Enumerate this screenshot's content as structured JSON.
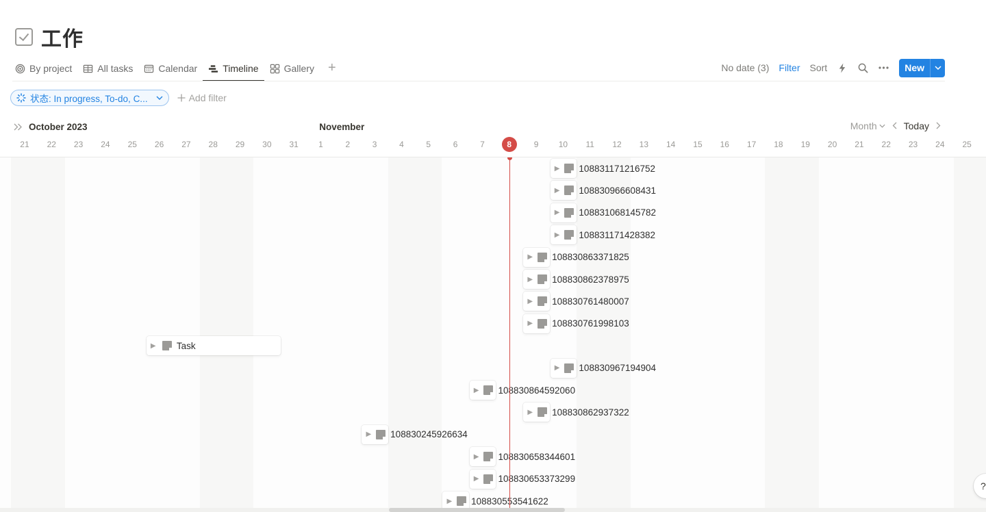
{
  "page": {
    "title": "工作",
    "title_icon": "checkbox-icon"
  },
  "views": {
    "tabs": [
      {
        "label": "By project",
        "icon": "target-icon",
        "active": false
      },
      {
        "label": "All tasks",
        "icon": "table-icon",
        "active": false
      },
      {
        "label": "Calendar",
        "icon": "calendar-icon",
        "active": false
      },
      {
        "label": "Timeline",
        "icon": "timeline-icon",
        "active": true
      },
      {
        "label": "Gallery",
        "icon": "gallery-icon",
        "active": false
      }
    ],
    "add_view_label": "+"
  },
  "toolbar": {
    "no_date": "No date (3)",
    "filter": "Filter",
    "sort": "Sort",
    "automation_icon": "lightning-icon",
    "search_icon": "search-icon",
    "more_icon": "ellipsis-icon",
    "new_label": "New"
  },
  "filters": {
    "status_chip": "状态: In progress, To-do, C...",
    "add_filter": "Add filter"
  },
  "timeline": {
    "expand_icon": "double-chevron-right-icon",
    "months": [
      {
        "label": "October 2023",
        "anchor_index": 0.6
      },
      {
        "label": "November",
        "anchor_index": 12.3
      }
    ],
    "view_mode": "Month",
    "today_label": "Today",
    "start_date": "2023-10-20",
    "days": [
      "0",
      "21",
      "22",
      "23",
      "24",
      "25",
      "26",
      "27",
      "28",
      "29",
      "30",
      "31",
      "1",
      "2",
      "3",
      "4",
      "5",
      "6",
      "7",
      "8",
      "9",
      "10",
      "11",
      "12",
      "13",
      "14",
      "15",
      "16",
      "17",
      "18",
      "19",
      "20",
      "21",
      "22",
      "23",
      "24",
      "25"
    ],
    "day_prefix_first": "20",
    "today_index": 19,
    "weekend_indices": [
      1,
      8,
      15,
      22,
      29,
      36
    ],
    "tasks": [
      {
        "label": "108831171216752",
        "start_index": 21,
        "days": 1
      },
      {
        "label": "108830966608431",
        "start_index": 21,
        "days": 1
      },
      {
        "label": "108831068145782",
        "start_index": 21,
        "days": 1
      },
      {
        "label": "108831171428382",
        "start_index": 21,
        "days": 1
      },
      {
        "label": "108830863371825",
        "start_index": 20,
        "days": 1
      },
      {
        "label": "108830862378975",
        "start_index": 20,
        "days": 1
      },
      {
        "label": "108830761480007",
        "start_index": 20,
        "days": 1
      },
      {
        "label": "108830761998103",
        "start_index": 20,
        "days": 1
      },
      {
        "label": "Task",
        "start_index": 6,
        "days": 5
      },
      {
        "label": "108830967194904",
        "start_index": 21,
        "days": 1
      },
      {
        "label": "108830864592060",
        "start_index": 18,
        "days": 1
      },
      {
        "label": "108830862937322",
        "start_index": 20,
        "days": 1
      },
      {
        "label": "108830245926634",
        "start_index": 14,
        "days": 1
      },
      {
        "label": "108830658344601",
        "start_index": 18,
        "days": 1
      },
      {
        "label": "108830653373299",
        "start_index": 18,
        "days": 1
      },
      {
        "label": "108830553541622",
        "start_index": 17,
        "days": 1
      }
    ]
  },
  "help": {
    "label": "?"
  }
}
